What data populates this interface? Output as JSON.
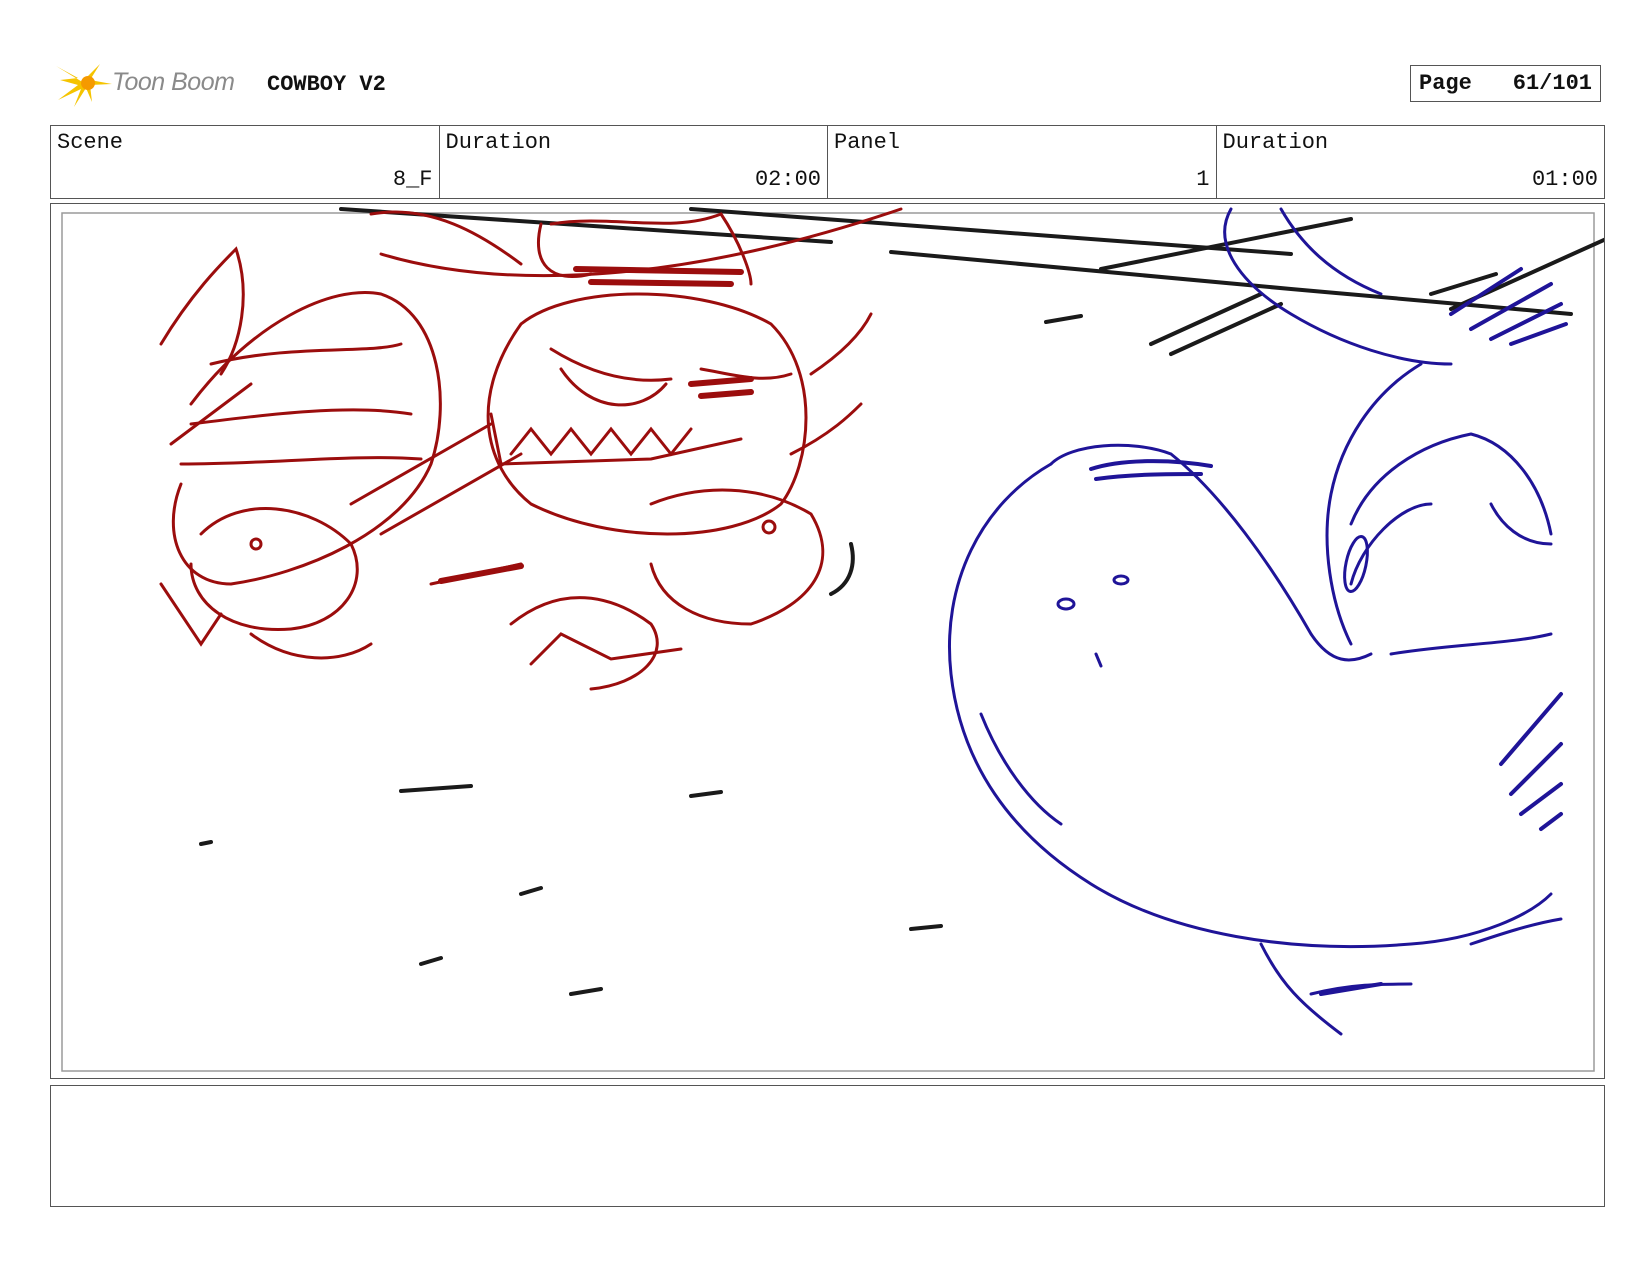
{
  "header": {
    "logo_text": "Toon Boom",
    "project_title": "COWBOY V2",
    "page_label": "Page",
    "page_number": "61/101"
  },
  "info": {
    "scene_label": "Scene",
    "scene_value": "8_F",
    "scene_duration_label": "Duration",
    "scene_duration_value": "02:00",
    "panel_label": "Panel",
    "panel_value": "1",
    "panel_duration_label": "Duration",
    "panel_duration_value": "01:00"
  },
  "notes": {
    "text": ""
  },
  "colors": {
    "villain_sketch": "#9b0d0d",
    "hero_sketch": "#1f1498",
    "background_sketch": "#1a1a1a",
    "logo_accent": "#f5c400"
  }
}
